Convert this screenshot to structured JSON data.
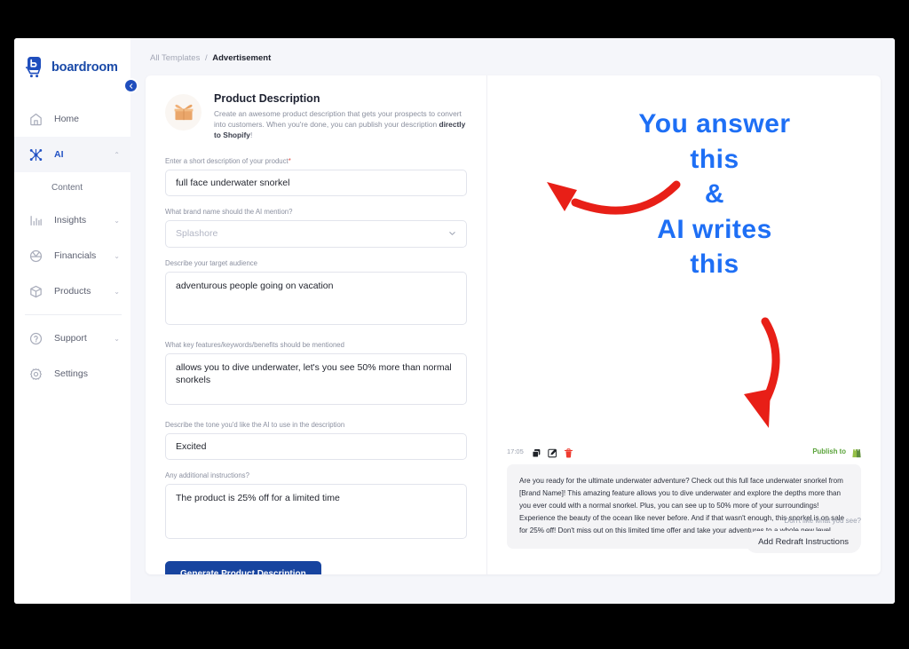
{
  "brand": {
    "name": "boardroom",
    "logo_icon": "boardroom-cart-logo",
    "accent_color": "#1f4ebd"
  },
  "sidebar": {
    "collapse_icon": "chevron-left-icon",
    "items": [
      {
        "label": "Home",
        "icon": "home-icon",
        "caret": "",
        "active": false
      },
      {
        "label": "AI",
        "icon": "ai-nodes-icon",
        "caret": "⌃",
        "active": true
      },
      {
        "label": "Insights",
        "icon": "bar-chart-icon",
        "caret": "⌄",
        "active": false
      },
      {
        "label": "Financials",
        "icon": "pie-chart-icon",
        "caret": "⌄",
        "active": false
      },
      {
        "label": "Products",
        "icon": "box-icon",
        "caret": "⌄",
        "active": false
      },
      {
        "label": "Support",
        "icon": "help-icon",
        "caret": "⌄",
        "active": false
      },
      {
        "label": "Settings",
        "icon": "gear-icon",
        "caret": "",
        "active": false
      }
    ],
    "sub_item": {
      "label": "Content"
    }
  },
  "breadcrumb": {
    "root": "All Templates",
    "separator": "/",
    "current": "Advertisement"
  },
  "template": {
    "icon": "open-box-icon",
    "title": "Product Description",
    "description_line1": "Create an awesome product description that gets your prospects to convert into customers.",
    "description_line2_pre": "When you're done, you can publish your description ",
    "description_line2_bold": "directly to Shopify",
    "description_line2_post": "!"
  },
  "form": {
    "fields": [
      {
        "name": "short-description",
        "label": "Enter a short description of your product",
        "required": true,
        "type": "input",
        "value": "full face underwater snorkel",
        "placeholder": ""
      },
      {
        "name": "brand-name",
        "label": "What brand name should the AI mention?",
        "required": false,
        "type": "select",
        "value": "",
        "placeholder": "Splashore",
        "caret_icon": "chevron-down-icon"
      },
      {
        "name": "target-audience",
        "label": "Describe your target audience",
        "required": false,
        "type": "textarea",
        "value": "adventurous people going on vacation",
        "placeholder": ""
      },
      {
        "name": "key-features",
        "label": "What key features/keywords/benefits should be mentioned",
        "required": false,
        "type": "textarea",
        "value": "allows you to dive underwater, let's you see 50% more than normal snorkels",
        "placeholder": ""
      },
      {
        "name": "tone",
        "label": "Describe the tone you'd like the AI to use in the description",
        "required": false,
        "type": "input",
        "value": "Excited",
        "placeholder": ""
      },
      {
        "name": "additional-instructions",
        "label": "Any additional instructions?",
        "required": false,
        "type": "textarea",
        "value": "The product is 25% off for a limited time",
        "placeholder": ""
      }
    ],
    "submit_label": "Generate Product Description"
  },
  "output": {
    "timestamp": "17:05",
    "actions": [
      {
        "name": "copy-icon",
        "title": "Copy"
      },
      {
        "name": "edit-icon",
        "title": "Edit"
      },
      {
        "name": "delete-icon",
        "title": "Delete"
      }
    ],
    "publish_label": "Publish to",
    "publish_icon": "shopify-bag-icon",
    "text": "Are you ready for the ultimate underwater adventure? Check out this full face underwater snorkel from [Brand Name]! This amazing feature allows you to dive underwater and explore the depths more than you ever could with a normal snorkel. Plus, you can see up to 50% more of your surroundings! Experience the beauty of the ocean like never before. And if that wasn't enough, this snorkel is on sale for 25% off! Don't miss out on this limited time offer and take your adventures to a whole new level.",
    "redraft_hint": "Don't like what you see?",
    "redraft_label": "Add Redraft Instructions"
  },
  "annotations": {
    "color": "#1e6ff5",
    "arrow_color": "#e81f17",
    "line1": "You answer",
    "line2": "this",
    "line3": "&",
    "line4": "AI writes",
    "line5": "this",
    "arrow_to_form": "curved-arrow-left-icon",
    "arrow_to_output": "curved-arrow-down-icon"
  }
}
